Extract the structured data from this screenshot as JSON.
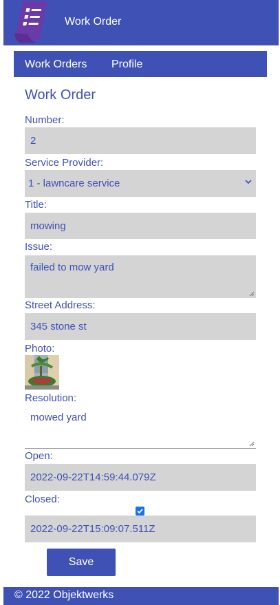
{
  "header": {
    "title": "Work Order",
    "logo_icon": "document-list-icon"
  },
  "nav": {
    "items": [
      {
        "label": "Work Orders"
      },
      {
        "label": "Profile"
      }
    ]
  },
  "form": {
    "title": "Work Order",
    "number": {
      "label": "Number:",
      "value": "2"
    },
    "service_provider": {
      "label": "Service Provider:",
      "value": "1 - lawncare service"
    },
    "title_field": {
      "label": "Title:",
      "value": "mowing"
    },
    "issue": {
      "label": "Issue:",
      "value": "failed to mow yard"
    },
    "street_address": {
      "label": "Street Address:",
      "value": "345 stone st"
    },
    "photo": {
      "label": "Photo:"
    },
    "resolution": {
      "label": "Resolution:",
      "value": "mowed yard"
    },
    "open": {
      "label": "Open:",
      "value": "2022-09-22T14:59:44.079Z"
    },
    "closed": {
      "label": "Closed:",
      "checked": true,
      "value": "2022-09-22T15:09:07.511Z"
    },
    "save_label": "Save"
  },
  "footer": {
    "text": "© 2022 Objektwerks"
  },
  "colors": {
    "primary": "#3f51b5",
    "field_bg": "#d4d4d4",
    "checkbox": "#1a73e8"
  }
}
